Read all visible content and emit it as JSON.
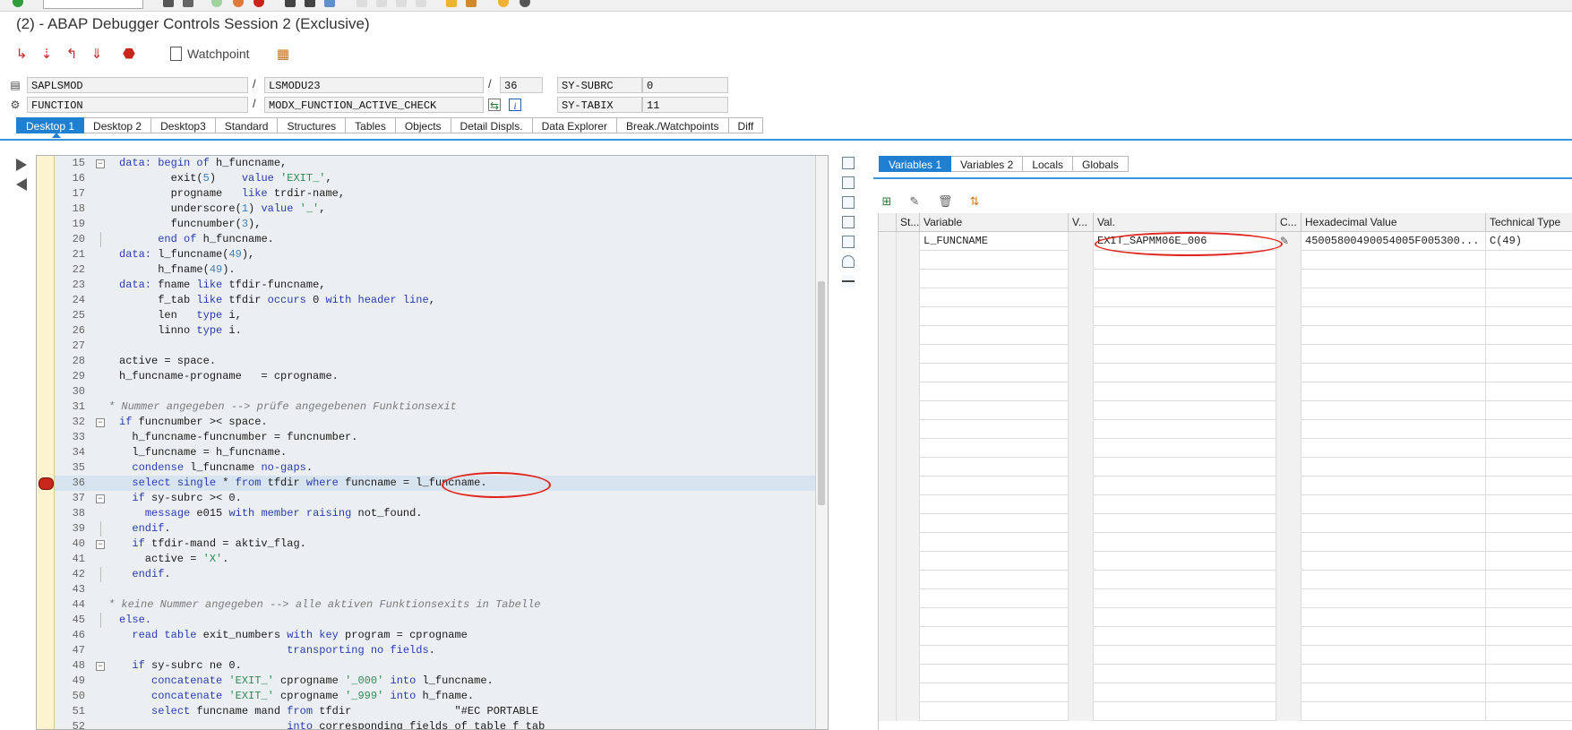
{
  "window": {
    "title": "(2) - ABAP Debugger Controls Session 2 (Exclusive)"
  },
  "toolbar": {
    "watchpoint_label": "Watchpoint"
  },
  "info": {
    "program": "SAPLSMOD",
    "include": "LSMODU23",
    "line": "36",
    "event_type": "FUNCTION",
    "event_name": "MODX_FUNCTION_ACTIVE_CHECK",
    "sy_subrc_label": "SY-SUBRC",
    "sy_subrc_value": "0",
    "sy_tabix_label": "SY-TABIX",
    "sy_tabix_value": "11",
    "separator": "/"
  },
  "desktop_tabs": [
    "Desktop 1",
    "Desktop 2",
    "Desktop3",
    "Standard",
    "Structures",
    "Tables",
    "Objects",
    "Detail Displs.",
    "Data Explorer",
    "Break./Watchpoints",
    "Diff"
  ],
  "code_lines": [
    {
      "n": "15",
      "t": "data: begin of h_funcname,"
    },
    {
      "n": "16",
      "t": "        exit(5)    value 'EXIT_',"
    },
    {
      "n": "17",
      "t": "        progname   like trdir-name,"
    },
    {
      "n": "18",
      "t": "        underscore(1) value '_',"
    },
    {
      "n": "19",
      "t": "        funcnumber(3),"
    },
    {
      "n": "20",
      "t": "      end of h_funcname."
    },
    {
      "n": "21",
      "t": "data: l_funcname(49),"
    },
    {
      "n": "22",
      "t": "      h_fname(49)."
    },
    {
      "n": "23",
      "t": "data: fname like tfdir-funcname,"
    },
    {
      "n": "24",
      "t": "      f_tab like tfdir occurs 0 with header line,"
    },
    {
      "n": "25",
      "t": "      len   type i,"
    },
    {
      "n": "26",
      "t": "      linno type i."
    },
    {
      "n": "27",
      "t": ""
    },
    {
      "n": "28",
      "t": "active = space."
    },
    {
      "n": "29",
      "t": "h_funcname-progname   = cprogname."
    },
    {
      "n": "30",
      "t": ""
    },
    {
      "n": "31",
      "t": "* Nummer angegeben --> prüfe angegebenen Funktionsexit"
    },
    {
      "n": "32",
      "t": "if funcnumber >< space."
    },
    {
      "n": "33",
      "t": "  h_funcname-funcnumber = funcnumber."
    },
    {
      "n": "34",
      "t": "  l_funcname = h_funcname."
    },
    {
      "n": "35",
      "t": "  condense l_funcname no-gaps."
    },
    {
      "n": "36",
      "t": "  select single * from tfdir where funcname = l_funcname."
    },
    {
      "n": "37",
      "t": "  if sy-subrc >< 0."
    },
    {
      "n": "38",
      "t": "    message e015 with member raising not_found."
    },
    {
      "n": "39",
      "t": "  endif."
    },
    {
      "n": "40",
      "t": "  if tfdir-mand = aktiv_flag."
    },
    {
      "n": "41",
      "t": "    active = 'X'."
    },
    {
      "n": "42",
      "t": "  endif."
    },
    {
      "n": "43",
      "t": ""
    },
    {
      "n": "44",
      "t": "* keine Nummer angegeben --> alle aktiven Funktionsexits in Tabelle"
    },
    {
      "n": "45",
      "t": "else."
    },
    {
      "n": "46",
      "t": "  read table exit_numbers with key program = cprogname"
    },
    {
      "n": "47",
      "t": "                          transporting no fields."
    },
    {
      "n": "48",
      "t": "  if sy-subrc ne 0."
    },
    {
      "n": "49",
      "t": "     concatenate 'EXIT_' cprogname '_000' into l_funcname."
    },
    {
      "n": "50",
      "t": "     concatenate 'EXIT_' cprogname '_999' into h_fname."
    },
    {
      "n": "51",
      "t": "     select funcname mand from tfdir                \"#EC PORTABLE"
    },
    {
      "n": "52",
      "t": "                          into corresponding fields of table f_tab"
    }
  ],
  "variable_tabs": [
    "Variables 1",
    "Variables 2",
    "Locals",
    "Globals"
  ],
  "variables_grid": {
    "headers": [
      "St...",
      "Variable",
      "V...",
      "Val.",
      "C...",
      "Hexadecimal Value",
      "Technical Type"
    ],
    "rows": [
      {
        "variable": "L_FUNCNAME",
        "value": "EXIT_SAPMM06E_006",
        "hex": "45005800490054005F005300...",
        "type": "C(49)"
      }
    ]
  },
  "colors": {
    "accent": "#1f7fd1",
    "annotation": "#e0241b",
    "breakpoint": "#c8261d"
  }
}
